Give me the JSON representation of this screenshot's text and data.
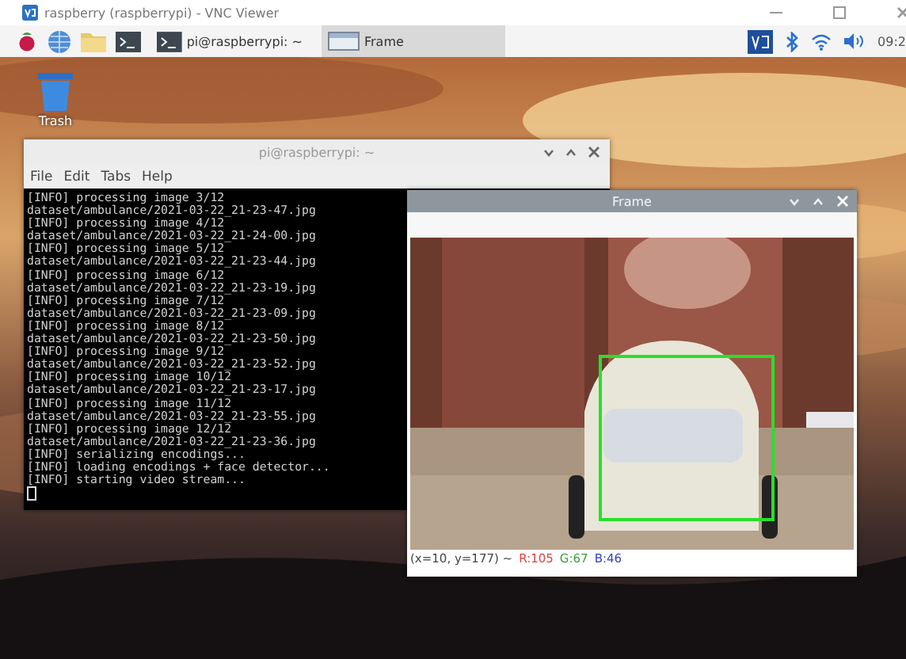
{
  "vnc_window": {
    "title": "raspberry (raspberrypi) - VNC Viewer"
  },
  "taskbar": {
    "tasks": [
      {
        "kind": "terminal",
        "label": "pi@raspberrypi: ~",
        "selected": false
      },
      {
        "kind": "window",
        "label": "Frame",
        "selected": true
      }
    ],
    "clock": "09:2"
  },
  "desktop_icons": [
    {
      "label": "Trash"
    }
  ],
  "terminal": {
    "title": "pi@raspberrypi: ~",
    "menu": [
      "File",
      "Edit",
      "Tabs",
      "Help"
    ],
    "lines": [
      "[INFO] processing image 3/12",
      "dataset/ambulance/2021-03-22_21-23-47.jpg",
      "[INFO] processing image 4/12",
      "dataset/ambulance/2021-03-22_21-24-00.jpg",
      "[INFO] processing image 5/12",
      "dataset/ambulance/2021-03-22_21-23-44.jpg",
      "[INFO] processing image 6/12",
      "dataset/ambulance/2021-03-22_21-23-19.jpg",
      "[INFO] processing image 7/12",
      "dataset/ambulance/2021-03-22_21-23-09.jpg",
      "[INFO] processing image 8/12",
      "dataset/ambulance/2021-03-22_21-23-50.jpg",
      "[INFO] processing image 9/12",
      "dataset/ambulance/2021-03-22_21-23-52.jpg",
      "[INFO] processing image 10/12",
      "dataset/ambulance/2021-03-22_21-23-17.jpg",
      "[INFO] processing image 11/12",
      "dataset/ambulance/2021-03-22_21-23-55.jpg",
      "[INFO] processing image 12/12",
      "dataset/ambulance/2021-03-22_21-23-36.jpg",
      "[INFO] serializing encodings...",
      "[INFO] loading encodings + face detector...",
      "[INFO] starting video stream..."
    ]
  },
  "frame_window": {
    "title": "Frame",
    "status": {
      "position": "(x=10, y=177) ~",
      "red": "R:105",
      "green": "G:67",
      "blue": "B:46"
    }
  }
}
